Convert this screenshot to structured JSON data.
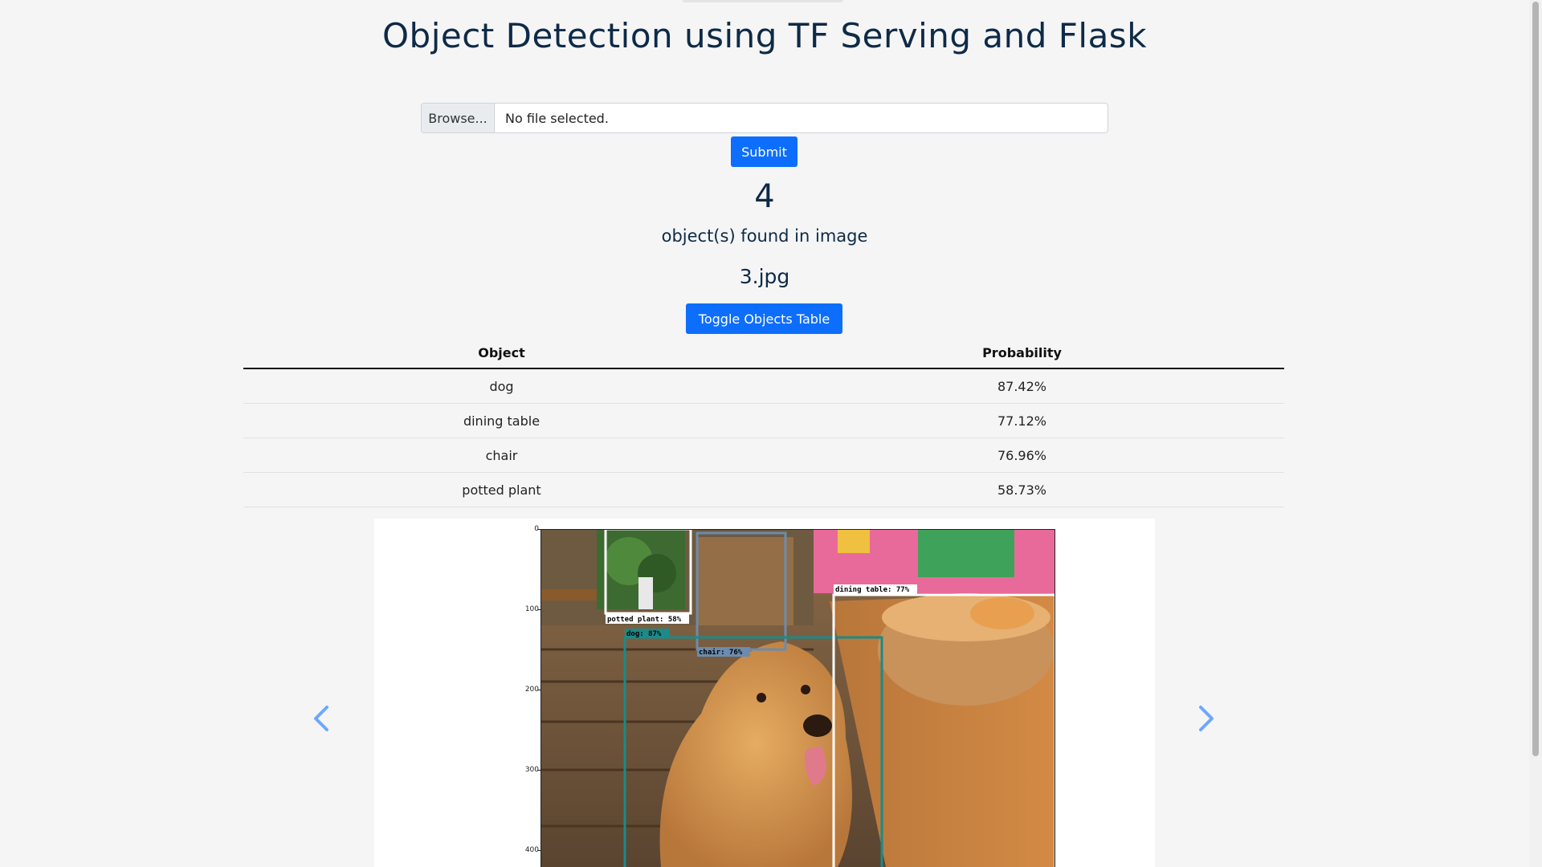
{
  "title": "Object Detection using TF Serving and Flask",
  "upload": {
    "browse_label": "Browse...",
    "file_status": "No file selected.",
    "submit_label": "Submit"
  },
  "result": {
    "count": "4",
    "count_label": "object(s) found in image",
    "filename": "3.jpg",
    "toggle_label": "Toggle Objects Table"
  },
  "table": {
    "headers": [
      "Object",
      "Probability"
    ],
    "rows": [
      {
        "object": "dog",
        "probability": "87.42%"
      },
      {
        "object": "dining table",
        "probability": "77.12%"
      },
      {
        "object": "chair",
        "probability": "76.96%"
      },
      {
        "object": "potted plant",
        "probability": "58.73%"
      }
    ]
  },
  "image_plot": {
    "y_ticks": [
      "0",
      "100",
      "200",
      "300",
      "400"
    ],
    "detections": [
      {
        "label": "potted plant: 58%",
        "color": "#ffffff"
      },
      {
        "label": "dog: 87%",
        "color": "#1a8a8a"
      },
      {
        "label": "chair: 76%",
        "color": "#6b8cae"
      },
      {
        "label": "dining table: 77%",
        "color": "#ffffff"
      }
    ]
  },
  "carousel": {
    "prev_icon": "chevron-left-icon",
    "next_icon": "chevron-right-icon",
    "arrow_color": "#6ea8fe"
  },
  "colors": {
    "primary": "#0d6efd",
    "heading": "#0e2a47",
    "background": "#f5f5f5"
  }
}
